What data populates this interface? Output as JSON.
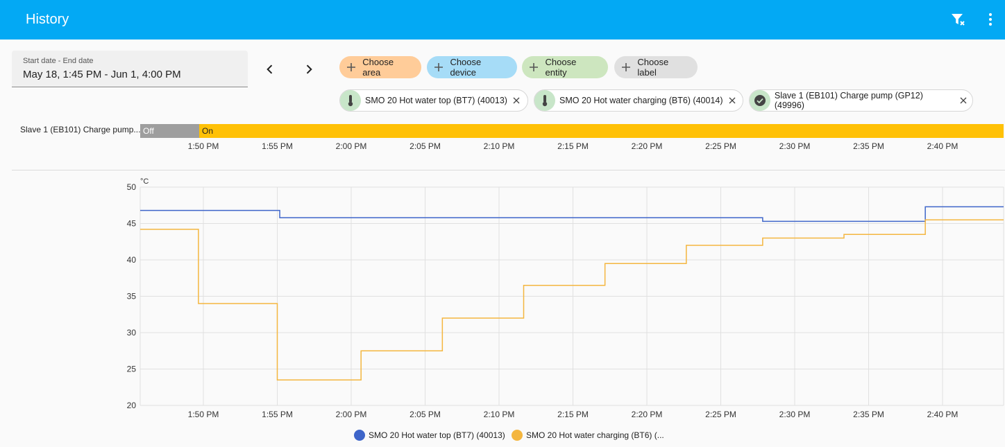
{
  "header": {
    "title": "History",
    "filter_icon": "filter-remove-icon",
    "menu_icon": "dots-vertical-icon"
  },
  "date_picker": {
    "label": "Start date - End date",
    "value": "May 18, 1:45 PM - Jun 1, 4:00 PM"
  },
  "nav": {
    "prev_icon": "chevron-left-icon",
    "next_icon": "chevron-right-icon"
  },
  "chips": [
    {
      "label": "Choose area",
      "color": "#ffcc99"
    },
    {
      "label": "Choose device",
      "color": "#a6dcf7"
    },
    {
      "label": "Choose entity",
      "color": "#cde6bf"
    },
    {
      "label": "Choose label",
      "color": "#e0e0e0"
    }
  ],
  "selected": [
    {
      "label": "SMO 20 Hot water top (BT7) (40013)",
      "icon": "thermometer-icon"
    },
    {
      "label": "SMO 20 Hot water charging (BT6) (40014)",
      "icon": "thermometer-icon"
    },
    {
      "label": "Slave 1 (EB101) Charge pump (GP12) (49996)",
      "icon": "check-circle-icon"
    }
  ],
  "timeline": {
    "label": "Slave 1 (EB101) Charge pump...",
    "segments": [
      {
        "state": "Off",
        "color": "#9e9e9e"
      },
      {
        "state": "On",
        "color": "#ffc107"
      }
    ]
  },
  "chart_data": {
    "type": "line",
    "ylabel": "°C",
    "ylim": [
      20,
      50
    ],
    "yticks": [
      "50",
      "45",
      "40",
      "35",
      "30",
      "25",
      "20"
    ],
    "xticks": [
      "1:50 PM",
      "1:55 PM",
      "2:00 PM",
      "2:05 PM",
      "2:10 PM",
      "2:15 PM",
      "2:20 PM",
      "2:25 PM",
      "2:30 PM",
      "2:35 PM",
      "2:40 PM"
    ],
    "series": [
      {
        "name": "SMO 20 Hot water top (BT7) (40013)",
        "legend": "SMO 20 Hot water top (BT7) (40013)",
        "color": "#3e65c9",
        "steps": [
          [
            "1:45:30 PM",
            46.8
          ],
          [
            "1:55:10 PM",
            45.8
          ],
          [
            "2:27:50 PM",
            45.3
          ],
          [
            "2:38:50 PM",
            47.3
          ],
          [
            "2:44:30 PM",
            47.3
          ]
        ]
      },
      {
        "name": "SMO 20 Hot water charging (BT6) (40014)",
        "legend": "SMO 20 Hot water charging (BT6) (...",
        "color": "#f4b63f",
        "steps": [
          [
            "1:45:30 PM",
            44.2
          ],
          [
            "1:49:40 PM",
            34.0
          ],
          [
            "1:55:00 PM",
            23.5
          ],
          [
            "2:00:40 PM",
            27.5
          ],
          [
            "2:06:10 PM",
            32.0
          ],
          [
            "2:11:40 PM",
            36.5
          ],
          [
            "2:17:10 PM",
            39.5
          ],
          [
            "2:22:40 PM",
            42.0
          ],
          [
            "2:27:50 PM",
            43.0
          ],
          [
            "2:33:20 PM",
            43.5
          ],
          [
            "2:38:50 PM",
            45.5
          ],
          [
            "2:44:30 PM",
            45.5
          ]
        ]
      }
    ]
  }
}
